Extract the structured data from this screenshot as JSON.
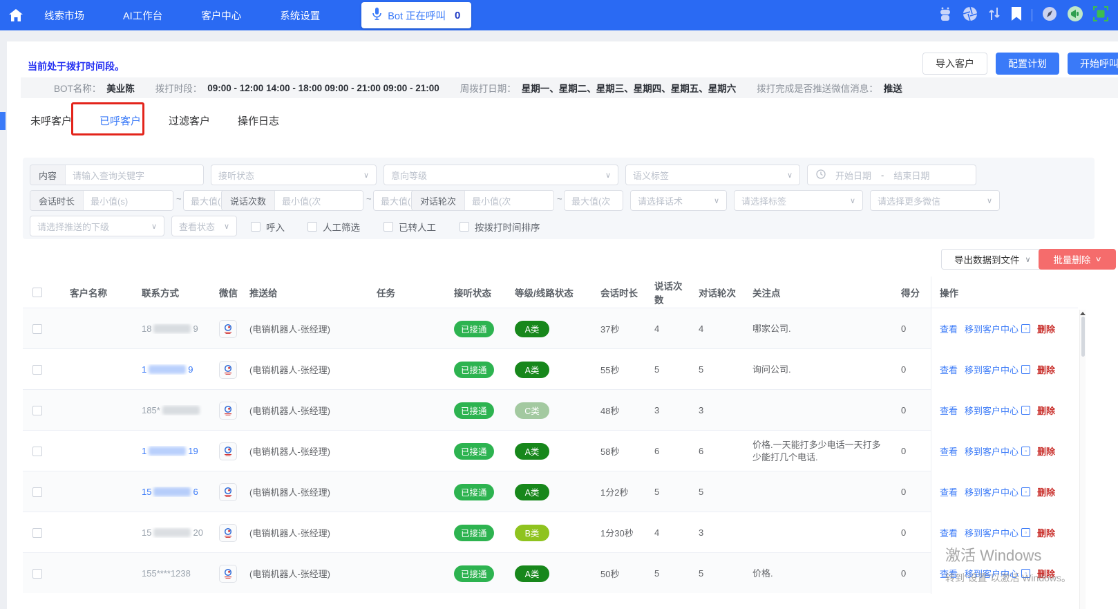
{
  "nav": {
    "items": [
      "线索市场",
      "AI工作台",
      "客户中心",
      "系统设置"
    ],
    "bot_pill": {
      "label": "Bot 正在呼叫",
      "count": "0"
    },
    "right_icons": [
      "robot",
      "aperture",
      "sort-arrows",
      "bookmark",
      "compass",
      "megaphone",
      "screenshot"
    ]
  },
  "page": {
    "alert": "当前处于拨打时间段。",
    "buttons": {
      "import": "导入客户",
      "configure": "配置计划",
      "start_call": "开始呼叫"
    },
    "info": [
      {
        "label": "BOT名称：",
        "value": "美业陈"
      },
      {
        "label": "拨打时段：",
        "value": "09:00 - 12:00 14:00 - 18:00 09:00 - 21:00 09:00 - 21:00"
      },
      {
        "label": "周拨打日期：",
        "value": "星期一、星期二、星期三、星期四、星期五、星期六"
      },
      {
        "label": "拨打完成是否推送微信消息：",
        "value": "推送"
      }
    ],
    "tabs": [
      {
        "label": "未呼客户"
      },
      {
        "label": "已呼客户"
      },
      {
        "label": "过滤客户"
      },
      {
        "label": "操作日志"
      }
    ]
  },
  "filters": {
    "row1": {
      "content_label": "内容",
      "content_placeholder": "请输入查询关键字",
      "answer_status": "接听状态",
      "intent_level": "意向等级",
      "semantic_tag": "语义标签",
      "date_start": "开始日期",
      "date_sep": "-",
      "date_end": "结束日期"
    },
    "row2": {
      "duration_label": "会话时长",
      "duration_min": "最小值(s)",
      "duration_max": "最大值(s)",
      "speak_label": "说话次数",
      "speak_min": "最小值(次",
      "speak_max": "最大值(次",
      "rounds_label": "对话轮次",
      "rounds_min": "最小值(次",
      "rounds_max": "最大值(次",
      "tilde": "~",
      "script_select": "请选择话术",
      "tag_select": "请选择标签",
      "wechat_select": "请选择更多微信"
    },
    "row3": {
      "subordinate_select": "请选择推送的下级",
      "view_status_select": "查看状态",
      "checkboxes": [
        "呼入",
        "人工筛选",
        "已转人工",
        "按拨打时间排序"
      ]
    }
  },
  "toolbar": {
    "export": "导出数据到文件",
    "batch_delete": "批量删除"
  },
  "table": {
    "columns": [
      "客户名称",
      "联系方式",
      "微信",
      "推送给",
      "任务",
      "接听状态",
      "等级/线路状态",
      "会话时长",
      "说话次数",
      "对话轮次",
      "关注点",
      "得分",
      "操作"
    ],
    "action_labels": {
      "view": "查看",
      "move": "移到客户中心",
      "delete": "删除"
    },
    "status_color": "#2db350",
    "rows": [
      {
        "phone": {
          "prefix": "18",
          "suffix": "9",
          "masked": true,
          "color": "#9aa3ad"
        },
        "pushed_to": "(电销机器人-张经理)",
        "task": "",
        "answer_status": "已接通",
        "grade": {
          "label": "A类",
          "color": "#17871b"
        },
        "duration": "37秒",
        "speak_count": "4",
        "rounds": "4",
        "focus": "哪家公司.",
        "score": "0"
      },
      {
        "phone": {
          "prefix": "1",
          "suffix": "9",
          "masked": true,
          "color": "#3a7af8"
        },
        "pushed_to": "(电销机器人-张经理)",
        "task": "",
        "answer_status": "已接通",
        "grade": {
          "label": "A类",
          "color": "#17871b"
        },
        "duration": "55秒",
        "speak_count": "5",
        "rounds": "5",
        "focus": "询问公司.",
        "score": "0"
      },
      {
        "phone": {
          "prefix": "185*",
          "suffix": "",
          "masked": true,
          "color": "#9aa3ad"
        },
        "pushed_to": "(电销机器人-张经理)",
        "task": "",
        "answer_status": "已接通",
        "grade": {
          "label": "C类",
          "color": "#a3c9a0"
        },
        "duration": "48秒",
        "speak_count": "3",
        "rounds": "3",
        "focus": "",
        "score": "0"
      },
      {
        "phone": {
          "prefix": "1",
          "suffix": "19",
          "masked": true,
          "color": "#3a7af8"
        },
        "pushed_to": "(电销机器人-张经理)",
        "task": "",
        "answer_status": "已接通",
        "grade": {
          "label": "A类",
          "color": "#17871b"
        },
        "duration": "58秒",
        "speak_count": "6",
        "rounds": "6",
        "focus": "价格.一天能打多少电话一天打多少能打几个电话.",
        "score": "0"
      },
      {
        "phone": {
          "prefix": "15",
          "suffix": "6",
          "masked": true,
          "color": "#3a7af8"
        },
        "pushed_to": "(电销机器人-张经理)",
        "task": "",
        "answer_status": "已接通",
        "grade": {
          "label": "A类",
          "color": "#17871b"
        },
        "duration": "1分2秒",
        "speak_count": "5",
        "rounds": "5",
        "focus": "",
        "score": "0"
      },
      {
        "phone": {
          "prefix": "15",
          "suffix": "20",
          "masked": true,
          "color": "#9aa3ad"
        },
        "pushed_to": "(电销机器人-张经理)",
        "task": "",
        "answer_status": "已接通",
        "grade": {
          "label": "B类",
          "color": "#8fc31f"
        },
        "duration": "1分30秒",
        "speak_count": "4",
        "rounds": "3",
        "focus": "",
        "score": "0"
      },
      {
        "phone": {
          "prefix": "155****1238",
          "suffix": "",
          "masked": false,
          "color": "#9aa3ad"
        },
        "pushed_to": "(电销机器人-张经理)",
        "task": "",
        "answer_status": "已接通",
        "grade": {
          "label": "A类",
          "color": "#17871b"
        },
        "duration": "50秒",
        "speak_count": "5",
        "rounds": "5",
        "focus": "价格.",
        "score": "0"
      }
    ]
  },
  "watermark": {
    "line1": "激活 Windows",
    "line2": "转到“设置”以激活 Windows。"
  }
}
